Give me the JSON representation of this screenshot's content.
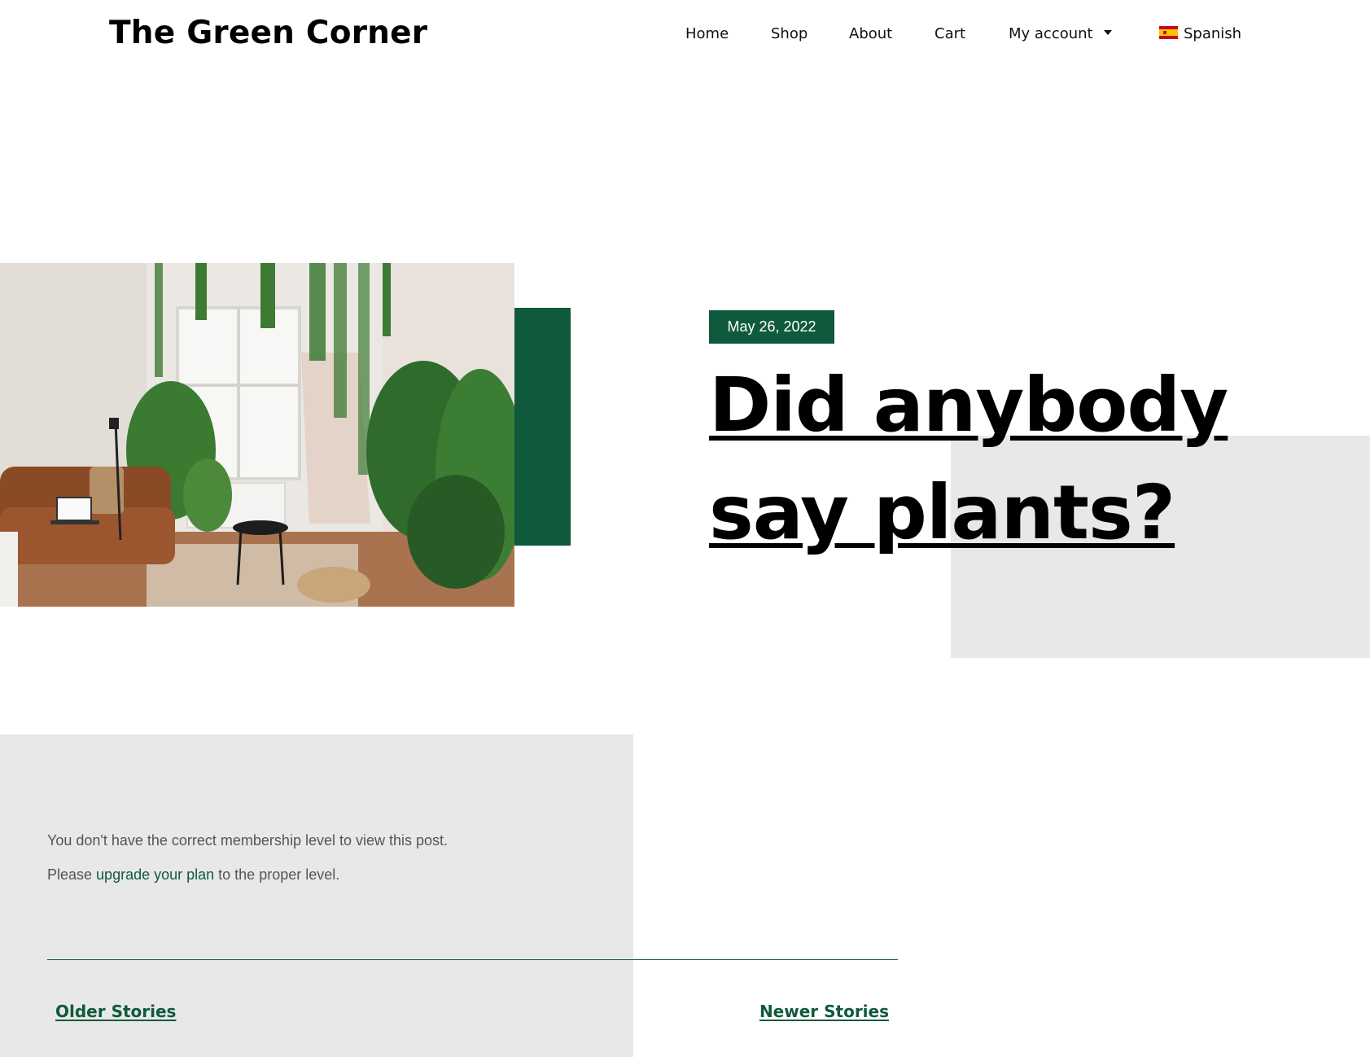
{
  "header": {
    "site_title": "The Green Corner",
    "nav": [
      {
        "label": "Home"
      },
      {
        "label": "Shop"
      },
      {
        "label": "About"
      },
      {
        "label": "Cart"
      },
      {
        "label": "My account",
        "icon": "caret-down-icon"
      },
      {
        "label": "Spanish",
        "icon": "spain-flag-icon"
      }
    ]
  },
  "post": {
    "date": "May 26, 2022",
    "title": "Did anybody say plants?",
    "image_alt": "Living room with leather sofa and many hanging and potted plants"
  },
  "content": {
    "restricted_line": "You don't have the correct membership level to view this post.",
    "upgrade_prefix": "Please ",
    "upgrade_link": "upgrade your plan",
    "upgrade_suffix": " to the proper level."
  },
  "pagination": {
    "older": "Older Stories",
    "newer": "Newer Stories"
  },
  "colors": {
    "brand_green": "#0f5a3c",
    "panel_grey": "#e8e8e8",
    "text_muted": "#555555"
  }
}
